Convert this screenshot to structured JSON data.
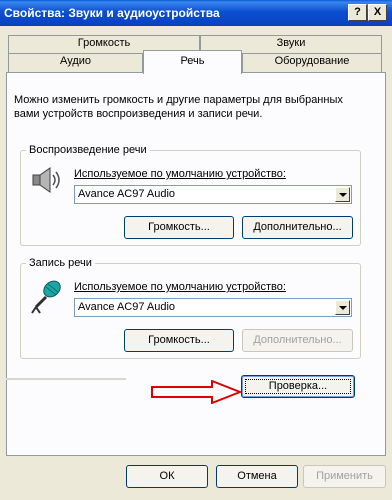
{
  "window": {
    "title": "Свойства: Звуки и аудиоустройства",
    "help_label": "?",
    "close_label": "X"
  },
  "tabs": {
    "row1": [
      {
        "label": "Громкость"
      },
      {
        "label": "Звуки"
      }
    ],
    "row2": [
      {
        "label": "Аудио"
      },
      {
        "label": "Речь"
      },
      {
        "label": "Оборудование"
      }
    ]
  },
  "speech": {
    "description": "Можно изменить громкость и другие параметры для выбранных вами устройств воспроизведения и записи речи.",
    "playback": {
      "group_label": "Воспроизведение речи",
      "device_label": "Используемое по умолчанию устройство:",
      "device_value": "Avance AC97 Audio",
      "volume_button": "Громкость...",
      "advanced_button": "Дополнительно..."
    },
    "recording": {
      "group_label": "Запись речи",
      "device_label": "Используемое по умолчанию устройство:",
      "device_value": "Avance AC97 Audio",
      "volume_button": "Громкость...",
      "advanced_button": "Дополнительно..."
    },
    "test_button": "Проверка..."
  },
  "footer": {
    "ok": "ОК",
    "cancel": "Отмена",
    "apply": "Применить"
  },
  "icons": {
    "playback": "speaker-icon",
    "recording": "microphone-icon",
    "annotation": "red-arrow-icon"
  },
  "colors": {
    "titlebar": "#0a5bd6",
    "face": "#ece9d8",
    "panel": "#fcfcfe",
    "annotation": "#e00000"
  }
}
